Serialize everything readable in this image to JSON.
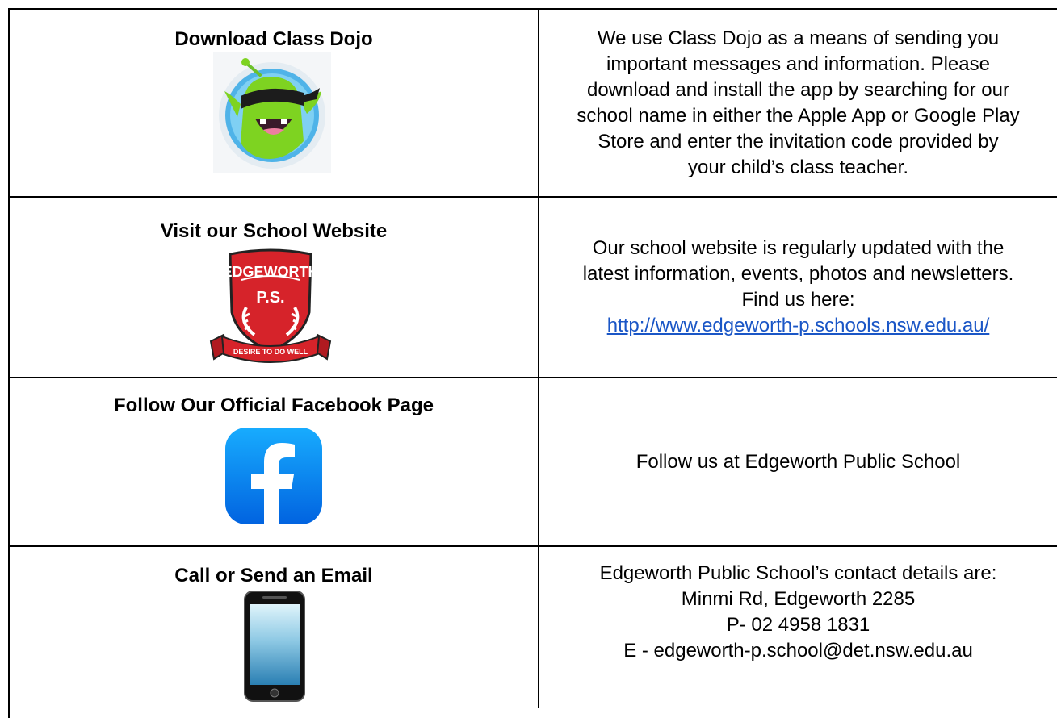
{
  "rows": [
    {
      "heading": "Download Class Dojo",
      "icon": "class-dojo-monster-icon",
      "lines": [
        "We use Class Dojo as a means of sending you",
        "important messages and information. Please",
        "download and install the app by searching for our",
        "school name in either the Apple App or Google Play",
        "Store and enter the invitation code provided by",
        "your child’s class teacher."
      ]
    },
    {
      "heading": "Visit our School Website",
      "icon": "school-crest-icon",
      "crest": {
        "top": "EDGEWORTH",
        "middle": "P.S.",
        "motto": "DESIRE TO DO WELL"
      },
      "lines": [
        "Our school website is regularly updated with the",
        "latest information, events, photos and newsletters.",
        "Find us here:"
      ],
      "link": "http://www.edgeworth-p.schools.nsw.edu.au/"
    },
    {
      "heading": "Follow Our Official Facebook Page",
      "icon": "facebook-icon",
      "lines": [
        "Follow us at Edgeworth Public School"
      ]
    },
    {
      "heading": "Call or Send an Email",
      "icon": "mobile-phone-icon",
      "lines": [
        "Edgeworth Public School’s contact details are:",
        "Minmi Rd, Edgeworth 2285",
        "P- 02 4958 1831",
        "E - edgeworth-p.school@det.nsw.edu.au"
      ]
    }
  ],
  "colors": {
    "link": "#1a56c6",
    "facebook_top": "#18acfe",
    "facebook_bottom": "#0163e0",
    "crest_red": "#d6232a",
    "dojo_green": "#7ed321"
  }
}
